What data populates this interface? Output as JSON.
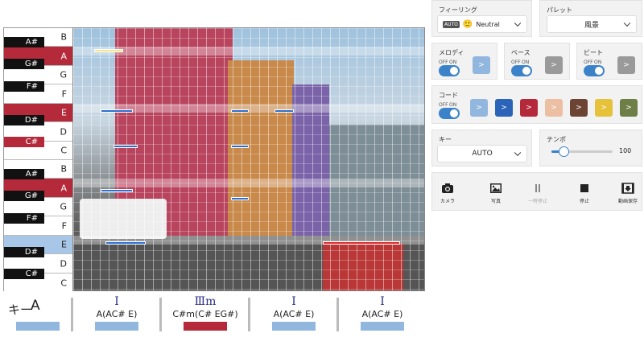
{
  "piano": {
    "white_keys": [
      "B",
      "A",
      "G",
      "F",
      "E",
      "D",
      "C",
      "B",
      "A",
      "G",
      "F",
      "E",
      "D",
      "C"
    ],
    "black_keys": [
      "A#",
      "G#",
      "F#",
      "D#",
      "C#",
      "A#",
      "G#",
      "F#",
      "D#",
      "C#"
    ]
  },
  "chords": {
    "key_label": "キー",
    "key_value": "A",
    "items": [
      {
        "roman": "Ⅰ",
        "name": "A(AC# E)"
      },
      {
        "roman": "Ⅲm",
        "name": "C#m(C# EG#)"
      },
      {
        "roman": "Ⅰ",
        "name": "A(AC# E)"
      },
      {
        "roman": "Ⅰ",
        "name": "A(AC# E)"
      }
    ],
    "colors": {
      "blue": "#92b7de",
      "red": "#b42a3a"
    }
  },
  "panel": {
    "feeling": {
      "title": "フィーリング",
      "badge": "AUTO",
      "emoji": "🙂",
      "value": "Neutral"
    },
    "palette": {
      "title": "パレット",
      "value": "風景"
    },
    "melody": {
      "title": "メロディ",
      "off": "OFF",
      "on": "ON",
      "btn": ">"
    },
    "bass": {
      "title": "ベース",
      "off": "OFF",
      "on": "ON",
      "btn": ">"
    },
    "beat": {
      "title": "ビート",
      "off": "OFF",
      "on": "ON",
      "btn": ">"
    },
    "chord": {
      "title": "コード",
      "off": "OFF",
      "on": "ON",
      "btn": ">",
      "swatches": [
        "#92b7de",
        "#2a63b8",
        "#b42a3a",
        "#ecbfa3",
        "#6b4434",
        "#e6c23a",
        "#6d7f47"
      ]
    },
    "key": {
      "title": "キー",
      "value": "AUTO"
    },
    "tempo": {
      "title": "テンポ",
      "value": "100",
      "level": 0.2
    },
    "tools": [
      {
        "label": "カメラ",
        "icon": "camera-icon"
      },
      {
        "label": "写真",
        "icon": "image-icon"
      },
      {
        "label": "一時停止",
        "icon": "pause-icon"
      },
      {
        "label": "停止",
        "icon": "stop-icon"
      },
      {
        "label": "動画保存",
        "icon": "video-save-icon"
      }
    ]
  }
}
